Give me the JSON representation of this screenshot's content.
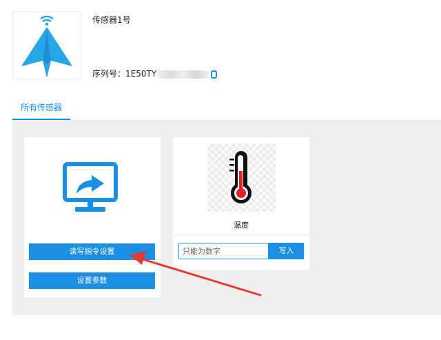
{
  "device": {
    "name": "传感器1号",
    "serial_label": "序列号：",
    "serial_visible": "1E50TY"
  },
  "tabs": [
    {
      "label": "所有传感器",
      "active": true
    }
  ],
  "cards": {
    "command": {
      "icon": "monitor-share-icon",
      "read_write_button": "读写指令设置",
      "params_button": "设置参数"
    },
    "sensor": {
      "icon": "thermometer-icon",
      "label": "温度",
      "input_placeholder": "只能为数字",
      "write_button": "写入"
    }
  },
  "colors": {
    "accent": "#1a8fe3",
    "content_bg": "#efefef",
    "annotation_arrow": "#e53a2f"
  }
}
